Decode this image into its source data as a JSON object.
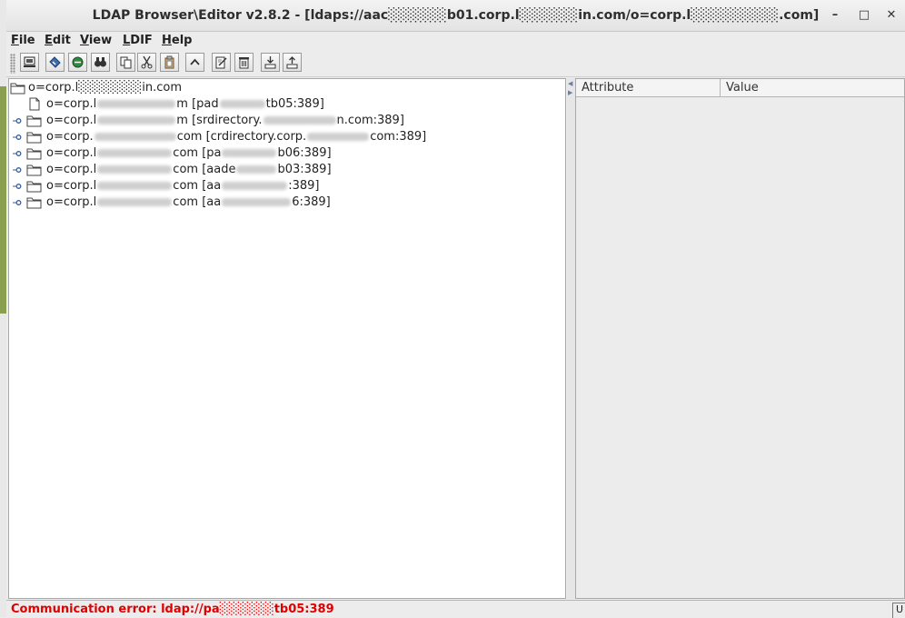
{
  "window": {
    "title": "LDAP Browser\\Editor v2.8.2 - [ldaps://aac░░░░░░b01.corp.l░░░░░░in.com/o=corp.l░░░░░░░░░.com]",
    "minimize_label": "–",
    "maximize_label": "□",
    "close_label": "✕"
  },
  "menubar": {
    "items": [
      {
        "mnemonic": "F",
        "rest": "ile"
      },
      {
        "mnemonic": "E",
        "rest": "dit"
      },
      {
        "mnemonic": "V",
        "rest": "iew"
      },
      {
        "mnemonic": "L",
        "rest": "DIF"
      },
      {
        "mnemonic": "H",
        "rest": "elp"
      }
    ]
  },
  "toolbar": {
    "icons": [
      "connect-icon",
      "reconnect-icon",
      "disconnect-icon",
      "search-icon",
      "copy-icon",
      "cut-icon",
      "paste-icon",
      "go-up-icon",
      "edit-icon",
      "delete-icon",
      "import-icon",
      "export-icon"
    ]
  },
  "tree": {
    "root_label": "o=corp.l░░░░░░░in.com",
    "children": [
      {
        "prefix": "o=corp.l",
        "suffix": "m [pad",
        "tail": "tb05:389]",
        "type": "leaf"
      },
      {
        "prefix": "o=corp.l",
        "suffix": "m [srdirectory.",
        "tail": "n.com:389]",
        "type": "folder"
      },
      {
        "prefix": "o=corp.",
        "suffix": "com [crdirectory.corp.",
        "tail": "com:389]",
        "type": "folder"
      },
      {
        "prefix": "o=corp.l",
        "suffix": "com [pa",
        "tail": "b06:389]",
        "type": "folder"
      },
      {
        "prefix": "o=corp.l",
        "suffix": "com [aade",
        "tail": "b03:389]",
        "type": "folder"
      },
      {
        "prefix": "o=corp.l",
        "suffix": "com [aa",
        "tail": ":389]",
        "type": "folder"
      },
      {
        "prefix": "o=corp.l",
        "suffix": "com [aa",
        "tail": "6:389]",
        "type": "folder"
      }
    ]
  },
  "attributes_table": {
    "columns": [
      "Attribute",
      "Value"
    ]
  },
  "status": {
    "message": "Communication error: ldap://pa░░░░░░tb05:389",
    "indicator": "U"
  },
  "colors": {
    "error": "#e00000",
    "tree_bg": "#ffffff",
    "window_bg": "#ececec"
  }
}
